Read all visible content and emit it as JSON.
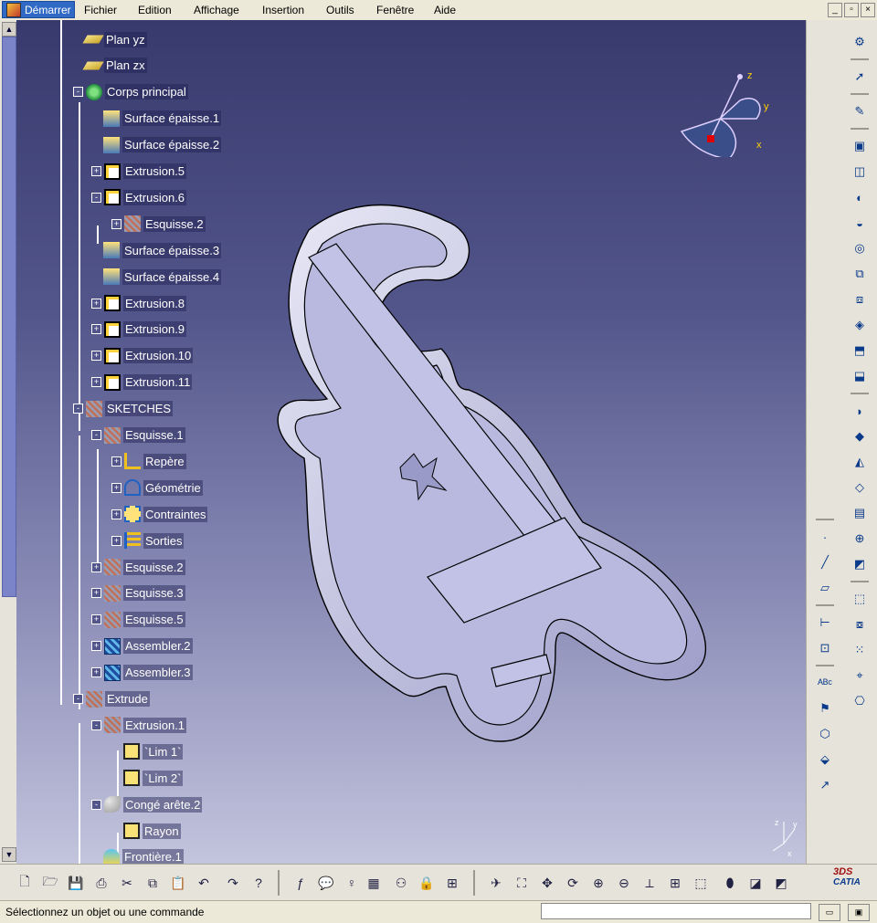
{
  "menubar": {
    "start_label": "Démarrer",
    "items": [
      "Fichier",
      "Edition",
      "Affichage",
      "Insertion",
      "Outils",
      "Fenêtre",
      "Aide"
    ]
  },
  "tree": {
    "nodes": [
      {
        "label": "Plan yz",
        "icon": "plane-icon"
      },
      {
        "label": "Plan zx",
        "icon": "plane-icon"
      },
      {
        "label": "Corps principal",
        "icon": "body-icon"
      },
      {
        "label": "Surface épaisse.1",
        "icon": "thick-surface-icon"
      },
      {
        "label": "Surface épaisse.2",
        "icon": "thick-surface-icon"
      },
      {
        "label": "Extrusion.5",
        "icon": "extrusion-icon"
      },
      {
        "label": "Extrusion.6",
        "icon": "extrusion-icon"
      },
      {
        "label": "Esquisse.2",
        "icon": "sketch-icon"
      },
      {
        "label": "Surface épaisse.3",
        "icon": "thick-surface-icon"
      },
      {
        "label": "Surface épaisse.4",
        "icon": "thick-surface-icon"
      },
      {
        "label": "Extrusion.8",
        "icon": "extrusion-icon"
      },
      {
        "label": "Extrusion.9",
        "icon": "extrusion-icon"
      },
      {
        "label": "Extrusion.10",
        "icon": "extrusion-icon"
      },
      {
        "label": "Extrusion.11",
        "icon": "extrusion-icon"
      },
      {
        "label": "SKETCHES",
        "icon": "geometric-set-icon"
      },
      {
        "label": "Esquisse.1",
        "icon": "sketch-icon"
      },
      {
        "label": "Repère",
        "icon": "axis-system-icon"
      },
      {
        "label": "Géométrie",
        "icon": "geometry-icon"
      },
      {
        "label": "Contraintes",
        "icon": "constraints-icon"
      },
      {
        "label": "Sorties",
        "icon": "outputs-icon"
      },
      {
        "label": "Esquisse.2",
        "icon": "sketch-icon"
      },
      {
        "label": "Esquisse.3",
        "icon": "sketch-icon"
      },
      {
        "label": "Esquisse.5",
        "icon": "sketch-icon"
      },
      {
        "label": "Assembler.2",
        "icon": "join-icon"
      },
      {
        "label": "Assembler.3",
        "icon": "join-icon"
      },
      {
        "label": "Extrude",
        "icon": "geometric-set-icon"
      },
      {
        "label": "Extrusion.1",
        "icon": "extrude-surface-icon"
      },
      {
        "label": "`Lim 1`",
        "icon": "limit-icon"
      },
      {
        "label": "`Lim 2`",
        "icon": "limit-icon"
      },
      {
        "label": "Congé arête.2",
        "icon": "edge-fillet-icon"
      },
      {
        "label": "Rayon",
        "icon": "limit-icon"
      },
      {
        "label": "Frontière.1",
        "icon": "boundary-icon"
      }
    ]
  },
  "compass": {
    "axis_labels": [
      "z",
      "y",
      "x"
    ]
  },
  "mini_axis": {
    "axis_labels": [
      "y",
      "z",
      "x"
    ]
  },
  "bottom_toolbar": {
    "logo_text": "CATIA",
    "logo_mark": "3DS"
  },
  "statusbar": {
    "message": "Sélectionnez un objet ou une commande",
    "command_value": ""
  },
  "colors": {
    "viewport_top": "#383a6e",
    "viewport_bottom": "#c3c4dd",
    "part_fill": "#b9b9e0",
    "part_edge": "#000000",
    "start_button": "#316ac5"
  }
}
